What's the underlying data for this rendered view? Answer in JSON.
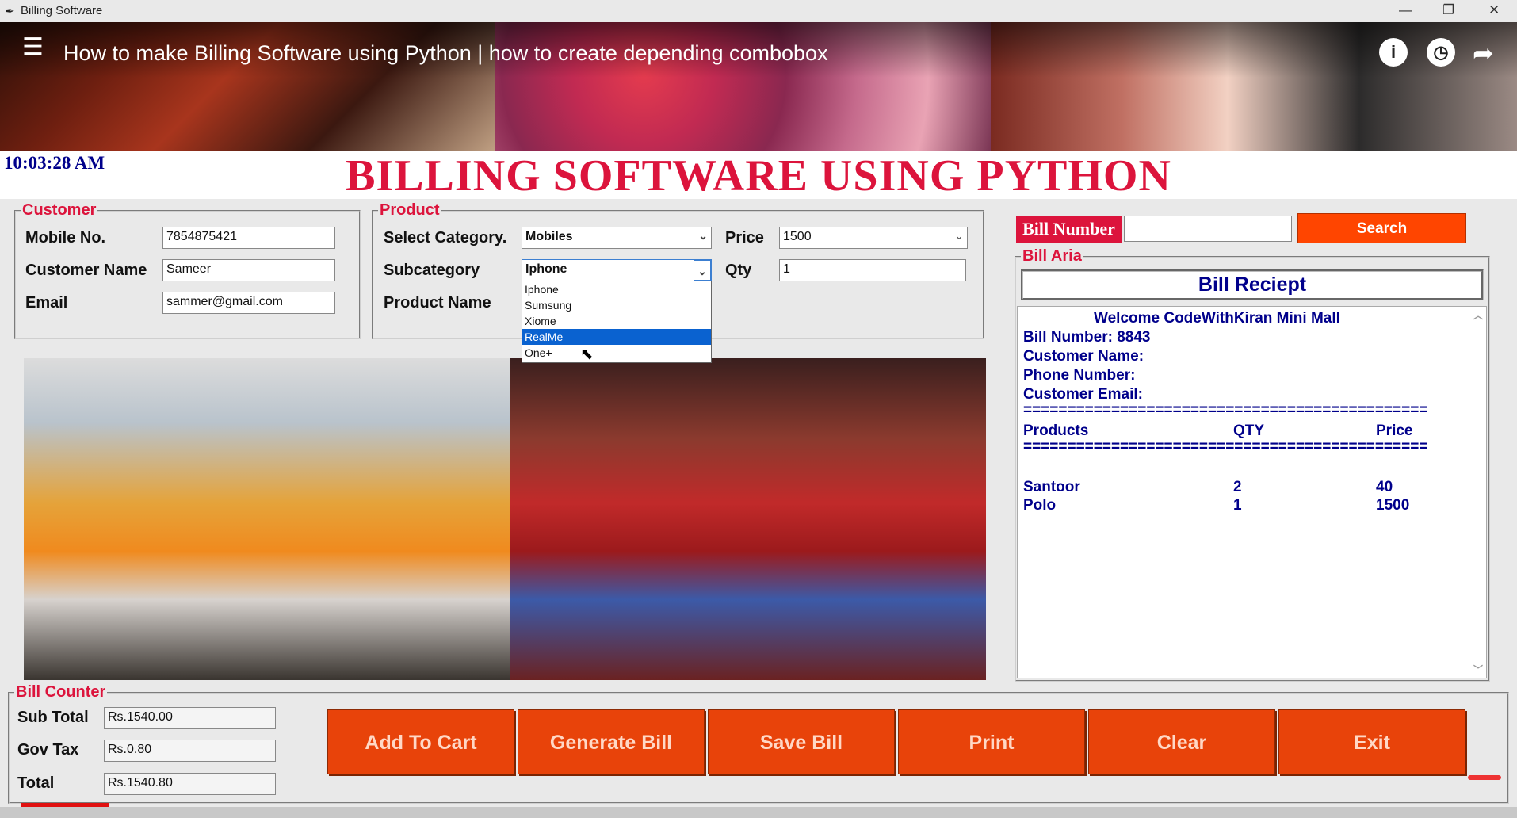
{
  "window": {
    "title": "Billing Software",
    "app_icon": "feather-icon"
  },
  "video": {
    "title": "How to make Billing Software using Python | how to create depending combobox"
  },
  "clock": "10:03:28 AM",
  "header": {
    "title": "BILLING SOFTWARE USING PYTHON"
  },
  "customer": {
    "legend": "Customer",
    "mobile_label": "Mobile No.",
    "mobile_value": "7854875421",
    "name_label": "Customer Name",
    "name_value": "Sameer",
    "email_label": "Email",
    "email_value": "sammer@gmail.com"
  },
  "product": {
    "legend": "Product",
    "category_label": "Select Category.",
    "category_value": "Mobiles",
    "subcategory_label": "Subcategory",
    "subcategory_value": "Iphone",
    "product_name_label": "Product Name",
    "price_label": "Price",
    "price_value": "1500",
    "qty_label": "Qty",
    "qty_value": "1",
    "subcategory_options": [
      "Iphone",
      "Sumsung",
      "Xiome",
      "RealMe",
      "One+"
    ],
    "highlighted_option": "RealMe"
  },
  "bill_search": {
    "label": "Bill Number",
    "value": "",
    "button": "Search"
  },
  "bill_area": {
    "legend": "Bill Aria",
    "title": "Bill Reciept",
    "welcome": "Welcome CodeWithKiran Mini Mall",
    "bill_number": "Bill Number: 8843",
    "customer_name": "Customer Name:",
    "phone_number": "Phone Number:",
    "customer_email": "Customer Email:",
    "separator": "==============================================",
    "columns": [
      "Products",
      "QTY",
      "Price"
    ],
    "items": [
      {
        "product": "Santoor",
        "qty": "2",
        "price": "40"
      },
      {
        "product": "Polo",
        "qty": "1",
        "price": "1500"
      }
    ]
  },
  "bill_counter": {
    "legend": "Bill Counter",
    "sub_total_label": "Sub Total",
    "sub_total_value": "Rs.1540.00",
    "gov_tax_label": "Gov Tax",
    "gov_tax_value": "Rs.0.80",
    "total_label": "Total",
    "total_value": "Rs.1540.80"
  },
  "buttons": {
    "add_to_cart": "Add To Cart",
    "generate_bill": "Generate Bill",
    "save_bill": "Save Bill",
    "print": "Print",
    "clear": "Clear",
    "exit": "Exit"
  },
  "colors": {
    "accent_red": "#dc143c",
    "button_orange": "#e8430a",
    "receipt_blue": "#00008b"
  }
}
